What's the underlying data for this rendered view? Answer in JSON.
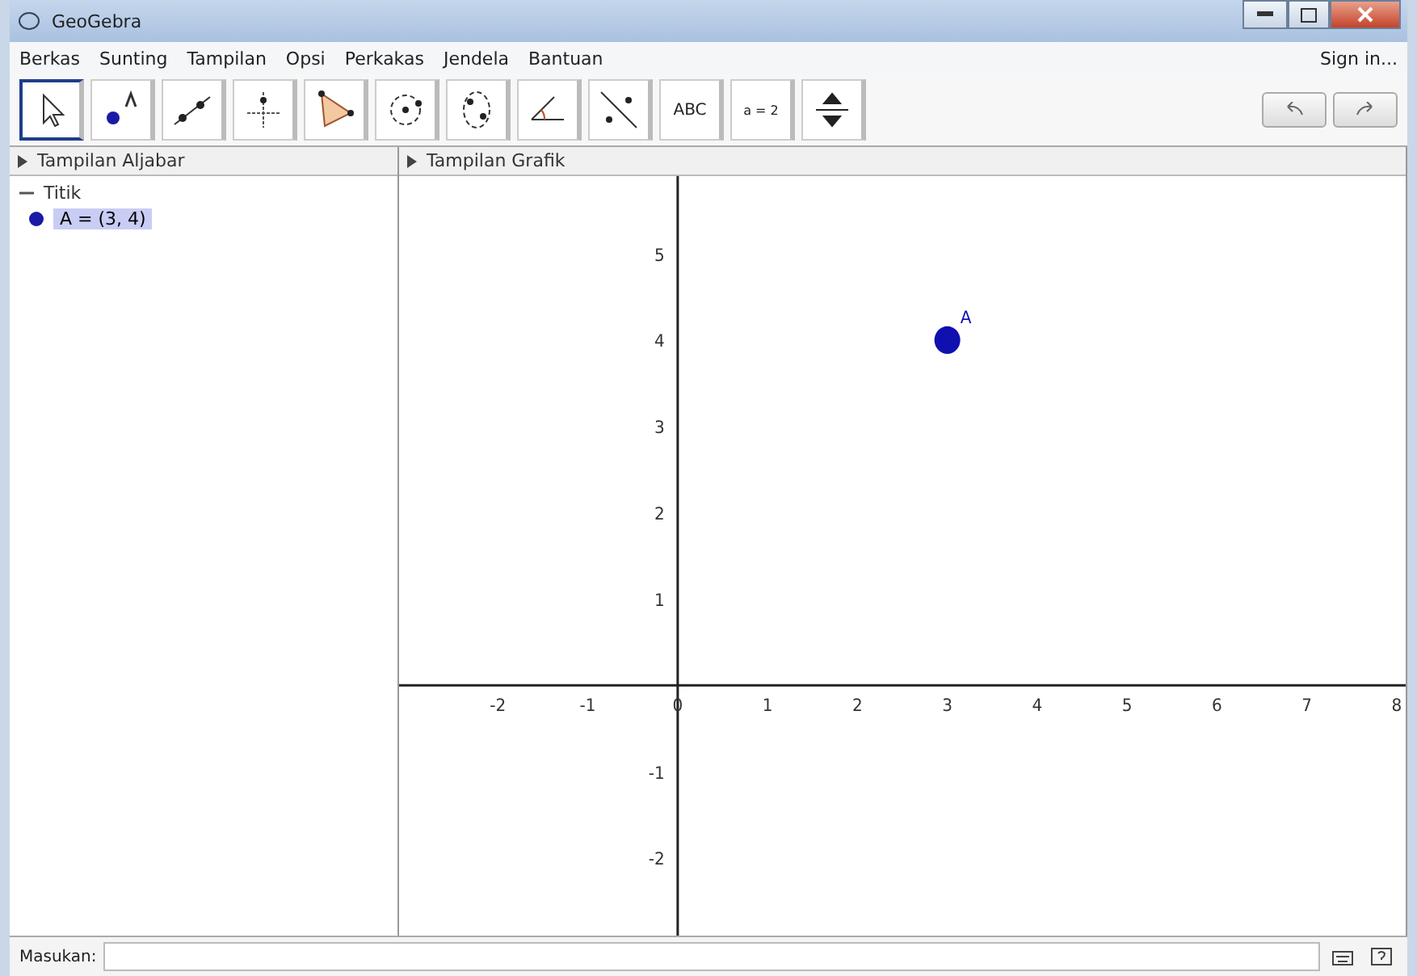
{
  "window": {
    "title": "GeoGebra"
  },
  "menu": [
    "Berkas",
    "Sunting",
    "Tampilan",
    "Opsi",
    "Perkakas",
    "Jendela",
    "Bantuan"
  ],
  "sign_in": "Sign in...",
  "toolbar": [
    {
      "kind": "move",
      "selected": true
    },
    {
      "kind": "point",
      "selected": false
    },
    {
      "kind": "line",
      "selected": false
    },
    {
      "kind": "perpendicular",
      "selected": false
    },
    {
      "kind": "polygon",
      "selected": false
    },
    {
      "kind": "circle",
      "selected": false
    },
    {
      "kind": "conic",
      "selected": false
    },
    {
      "kind": "angle",
      "selected": false
    },
    {
      "kind": "reflect",
      "selected": false
    },
    {
      "kind": "text",
      "label": "ABC",
      "selected": false
    },
    {
      "kind": "slider",
      "label": "a = 2",
      "selected": false
    },
    {
      "kind": "view",
      "selected": false
    }
  ],
  "algebra_view": {
    "title": "Tampilan Aljabar",
    "items": [
      {
        "label": "Titik",
        "expanded": true,
        "children": [
          {
            "label": "A = (3, 4)",
            "color": "#1a1aa6"
          }
        ]
      }
    ]
  },
  "graphics_view": {
    "title": "Tampilan Grafik",
    "chart_data": {
      "type": "scatter",
      "x": [
        3
      ],
      "series": [
        {
          "name": "A",
          "color": "#1010b0",
          "values": [
            4
          ]
        }
      ],
      "xlim": [
        -3.1,
        8.1
      ],
      "ylim": [
        -2.9,
        5.9
      ],
      "xticks": [
        -2,
        -1,
        0,
        1,
        2,
        3,
        4,
        5,
        6,
        7,
        8
      ],
      "yticks": [
        -2,
        -1,
        1,
        2,
        3,
        4,
        5
      ]
    }
  },
  "input_bar": {
    "label": "Masukan:"
  }
}
